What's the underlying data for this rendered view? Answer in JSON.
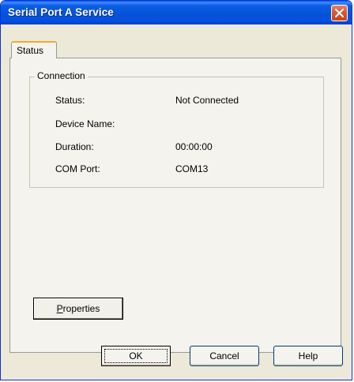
{
  "window": {
    "title": "Serial Port A Service"
  },
  "tabs": [
    {
      "label": "Status"
    }
  ],
  "connection": {
    "group_label": "Connection",
    "fields": [
      {
        "label": "Status:",
        "value": "Not Connected"
      },
      {
        "label": "Device Name:",
        "value": ""
      },
      {
        "label": "Duration:",
        "value": "00:00:00"
      },
      {
        "label": "COM Port:",
        "value": "COM13"
      }
    ]
  },
  "buttons": {
    "properties_mnemonic": "P",
    "properties_rest": "roperties",
    "ok": "OK",
    "cancel": "Cancel",
    "help": "Help"
  },
  "icons": {
    "close": "close-icon"
  }
}
